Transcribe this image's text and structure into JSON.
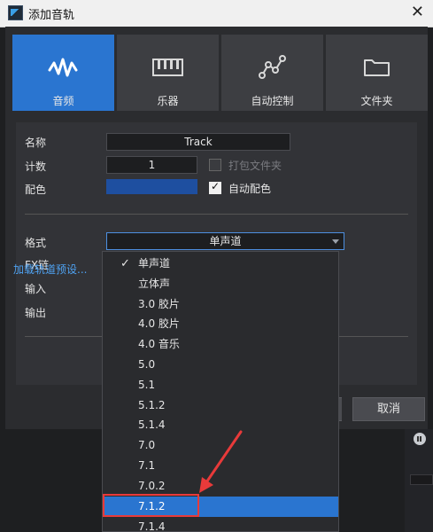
{
  "window": {
    "title": "添加音轨"
  },
  "track_types": [
    {
      "label": "音频",
      "icon": "waveform-icon",
      "active": true
    },
    {
      "label": "乐器",
      "icon": "piano-keys-icon",
      "active": false
    },
    {
      "label": "自动控制",
      "icon": "automation-curve-icon",
      "active": false
    },
    {
      "label": "文件夹",
      "icon": "folder-icon",
      "active": false
    }
  ],
  "form": {
    "name_label": "名称",
    "name_value": "Track",
    "count_label": "计数",
    "count_value": "1",
    "pack_folder_label": "打包文件夹",
    "pack_folder_checked": false,
    "color_label": "配色",
    "color_value": "#1e4fa0",
    "auto_color_label": "自动配色",
    "auto_color_checked": true,
    "format_label": "格式",
    "format_value": "单声道",
    "fx_chain_label": "FX链",
    "input_label": "输入",
    "output_label": "输出",
    "load_preset_link": "加载轨道预设..."
  },
  "buttons": {
    "cancel": "取消"
  },
  "format_options": {
    "selected": "单声道",
    "highlighted": "7.1.2",
    "items": [
      "单声道",
      "立体声",
      "3.0 胶片",
      "4.0 胶片",
      "4.0 音乐",
      "5.0",
      "5.1",
      "5.1.2",
      "5.1.4",
      "7.0",
      "7.1",
      "7.0.2",
      "7.1.2",
      "7.1.4"
    ]
  },
  "colors": {
    "accent": "#2a75d0",
    "annotation": "#e83a3a",
    "link": "#4ea1f0"
  }
}
